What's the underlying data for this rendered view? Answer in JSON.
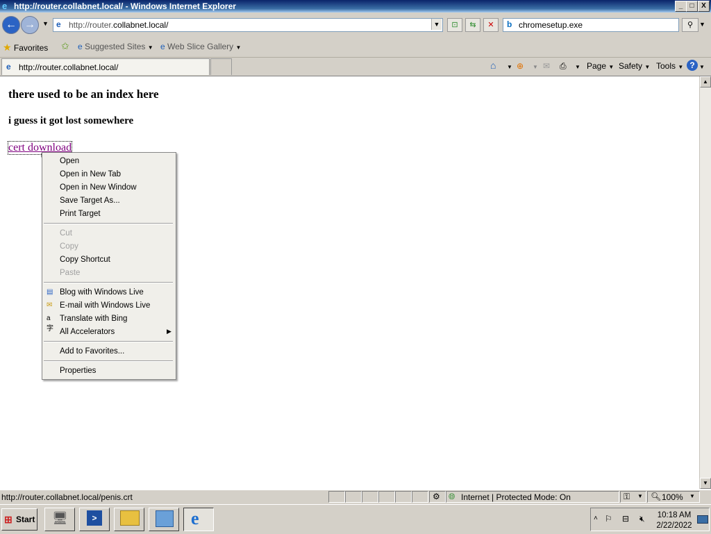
{
  "window": {
    "title": "http://router.collabnet.local/ - Windows Internet Explorer",
    "min_glyph": "_",
    "max_glyph": "□",
    "close_glyph": "X"
  },
  "nav": {
    "address_value_prefix": "http://router.",
    "address_value_host": "collabnet.local/",
    "search_value": "chromesetup.exe"
  },
  "favorites_bar": {
    "favorites": "Favorites",
    "suggested_sites": "Suggested Sites",
    "web_slice_gallery": "Web Slice Gallery"
  },
  "tab": {
    "title": "http://router.collabnet.local/"
  },
  "command_bar": {
    "page": "Page",
    "safety": "Safety",
    "tools": "Tools"
  },
  "page": {
    "heading1": "there used to be an index here",
    "heading2": "i guess it got lost somewhere",
    "link": "cert download"
  },
  "context_menu": {
    "group1": [
      "Open",
      "Open in New Tab",
      "Open in New Window",
      "Save Target As...",
      "Print Target"
    ],
    "group2": [
      {
        "label": "Cut",
        "enabled": false
      },
      {
        "label": "Copy",
        "enabled": false
      },
      {
        "label": "Copy Shortcut",
        "enabled": true
      },
      {
        "label": "Paste",
        "enabled": false
      }
    ],
    "group3": [
      "Blog with Windows Live",
      "E-mail with Windows Live",
      "Translate with Bing",
      "All Accelerators"
    ],
    "group4": [
      "Add to Favorites..."
    ],
    "group5": [
      "Properties"
    ]
  },
  "status_bar": {
    "url": "http://router.collabnet.local/penis.crt",
    "zone": "Internet | Protected Mode: On",
    "zoom": "100%"
  },
  "taskbar": {
    "start": "Start",
    "time": "10:18 AM",
    "date": "2/22/2022"
  },
  "colors": {
    "visited_link": "#800080",
    "titlebar": "#0a246a",
    "chrome": "#d4d0c8"
  }
}
